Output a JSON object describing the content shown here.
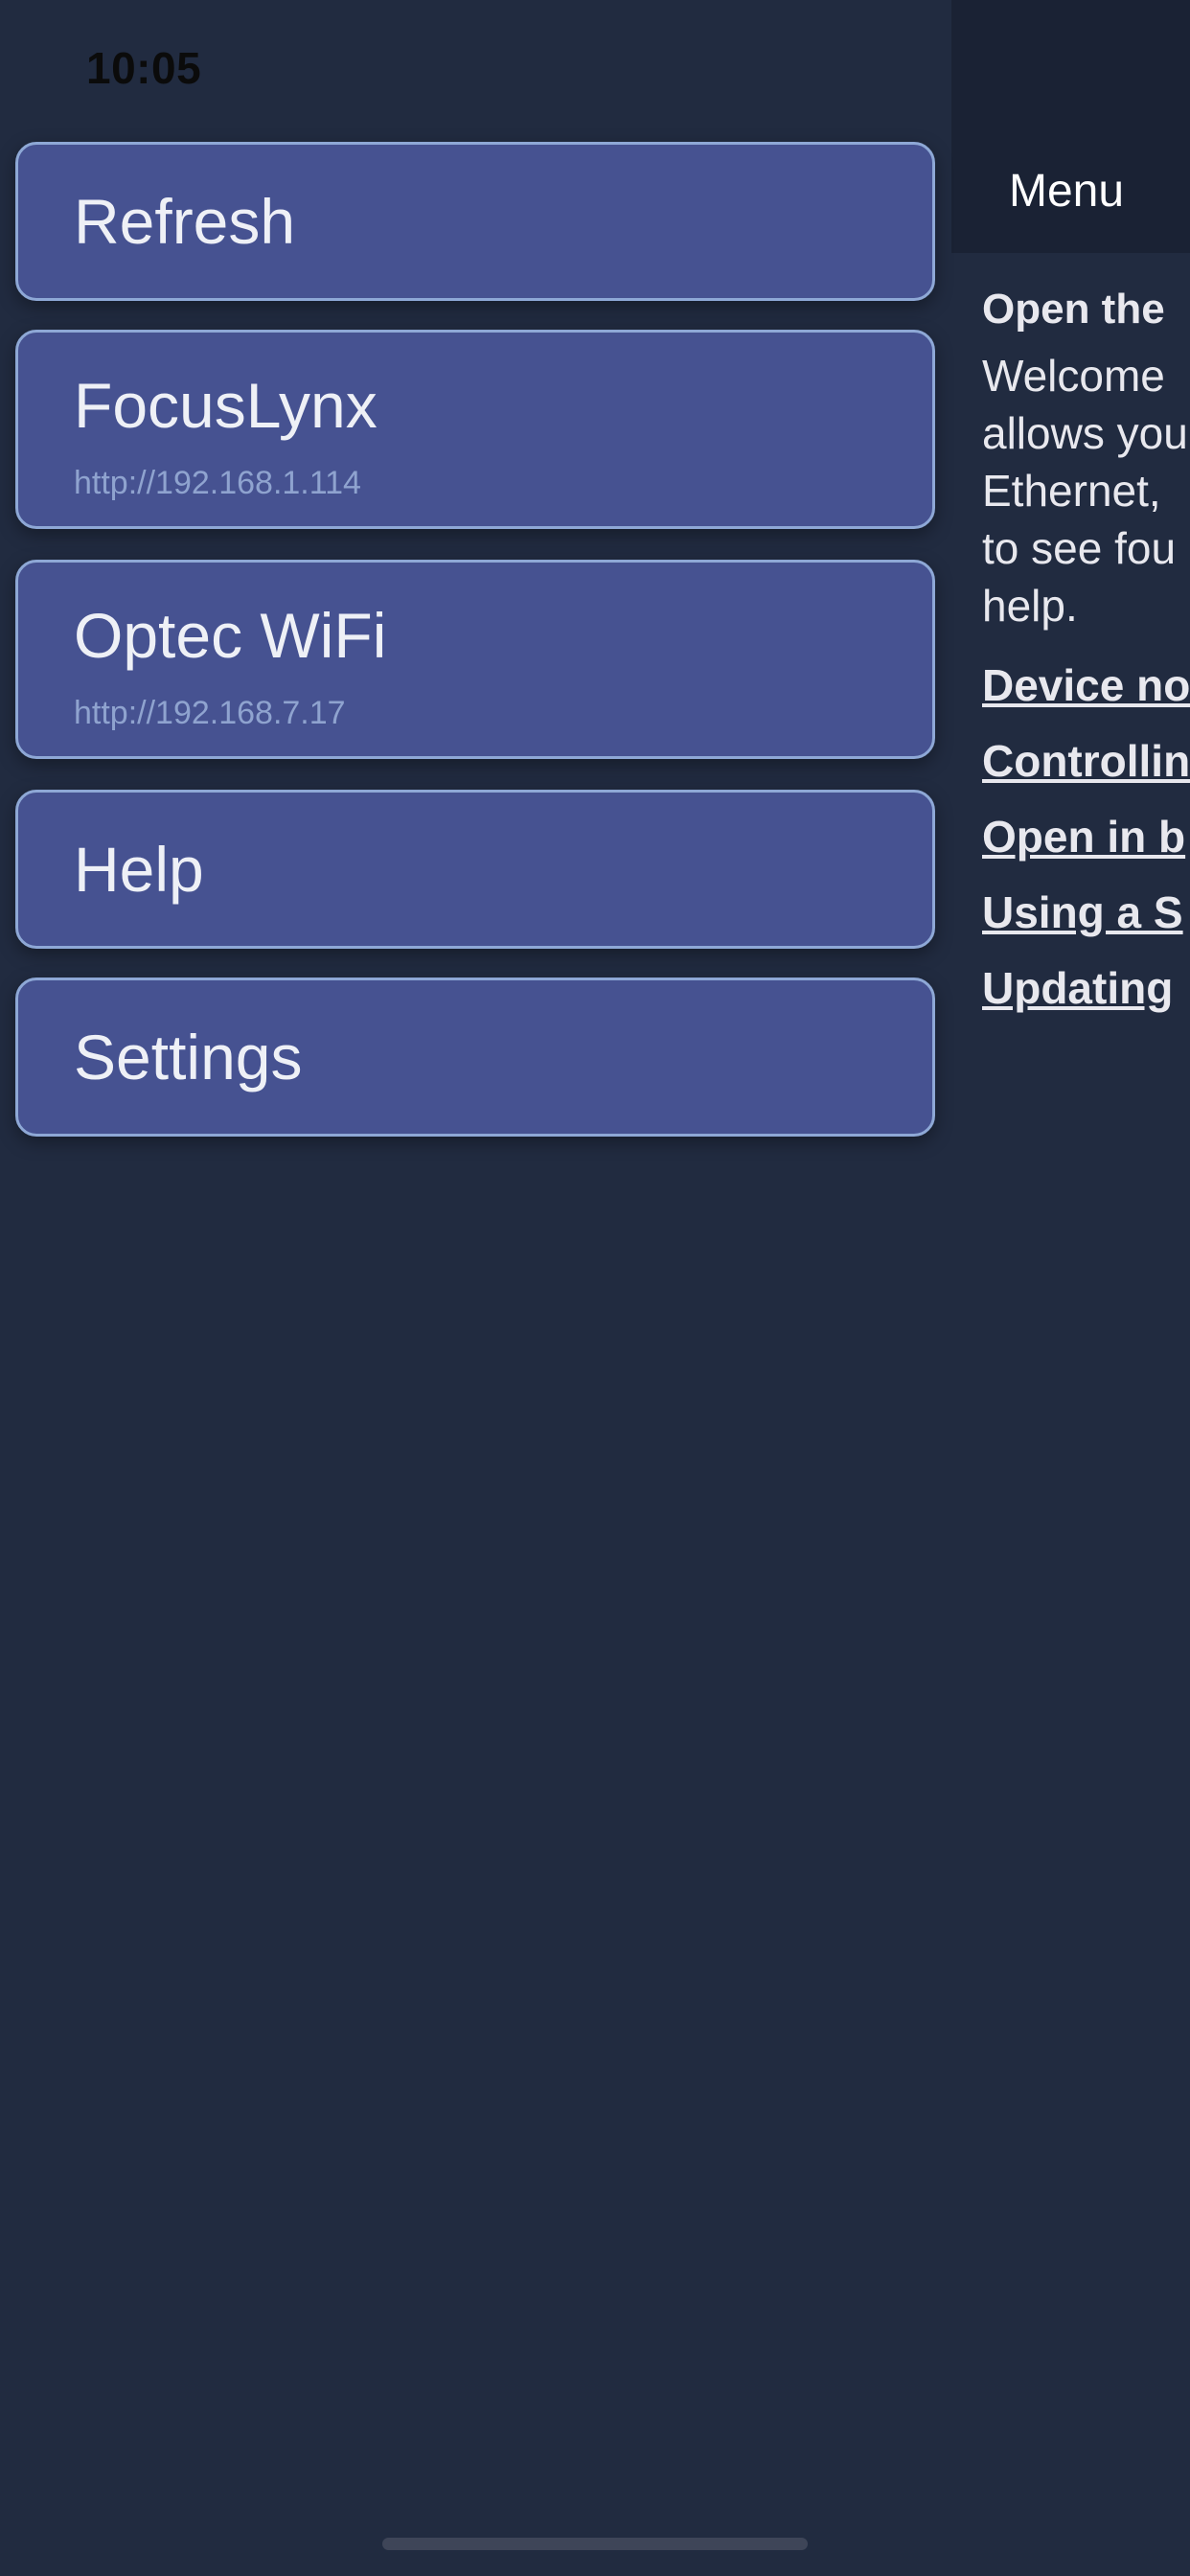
{
  "status_bar": {
    "time": "10:05"
  },
  "header": {
    "title": "Menu"
  },
  "menu": {
    "items": [
      {
        "label": "Refresh",
        "subtitle": ""
      },
      {
        "label": "FocusLynx",
        "subtitle": "http://192.168.1.114"
      },
      {
        "label": "Optec WiFi",
        "subtitle": "http://192.168.7.17"
      },
      {
        "label": "Help",
        "subtitle": ""
      },
      {
        "label": "Settings",
        "subtitle": ""
      }
    ]
  },
  "help": {
    "heading": "Open the",
    "text_lines": [
      "Welcome",
      "allows you",
      "Ethernet,",
      "to see fou",
      "help."
    ],
    "links": [
      "Device no",
      "Controllin",
      "Open in b",
      "Using a S",
      "Updating"
    ]
  },
  "colors": {
    "background": "#212b40",
    "menu_item_fill": "#465291",
    "menu_item_border": "#8ea8d6",
    "battery": "#34c759"
  },
  "icons": {
    "wifi": "wifi-icon",
    "battery": "battery-charging-icon"
  }
}
